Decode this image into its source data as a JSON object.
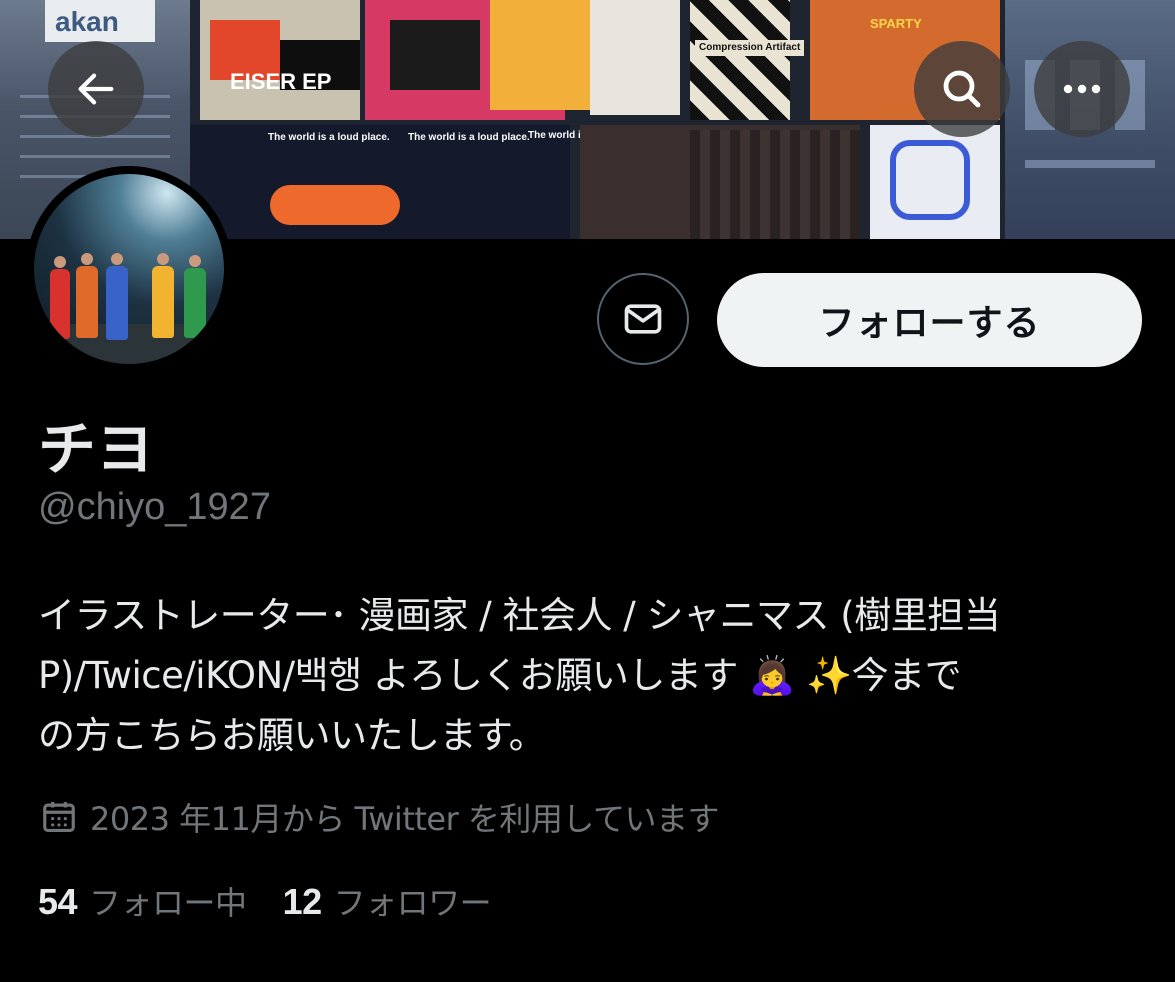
{
  "banner": {
    "sign_text": "akan",
    "posters": [
      "The world is a loud place.",
      "The world is a loud place.",
      "The world is a loud place.",
      "Compression Artifact",
      "SPARTY",
      "EISER EP"
    ]
  },
  "icons": {
    "back": "arrow-left-icon",
    "search": "search-icon",
    "more": "more-dots-icon",
    "message": "envelope-icon",
    "calendar": "calendar-icon"
  },
  "actions": {
    "follow_label": "フォローする"
  },
  "profile": {
    "display_name": "チヨ",
    "handle": "@chiyo_1927",
    "bio": "イラストレーター･ 漫画家 / 社会人 / シャニマス (樹里担当\nP)/Twice/iKON/백행 よろしくお願いします 🙇‍♀️ ✨今まで\nの方こちらお願いいたします。",
    "joined": "2023 年11月から Twitter を利用しています"
  },
  "stats": {
    "following_count": "54",
    "following_label": "フォロー中",
    "followers_count": "12",
    "followers_label": "フォロワー"
  },
  "colors": {
    "background": "#000000",
    "primary_text": "#e7e9ea",
    "secondary_text": "#71767b",
    "follow_button_bg": "#eff3f4"
  }
}
